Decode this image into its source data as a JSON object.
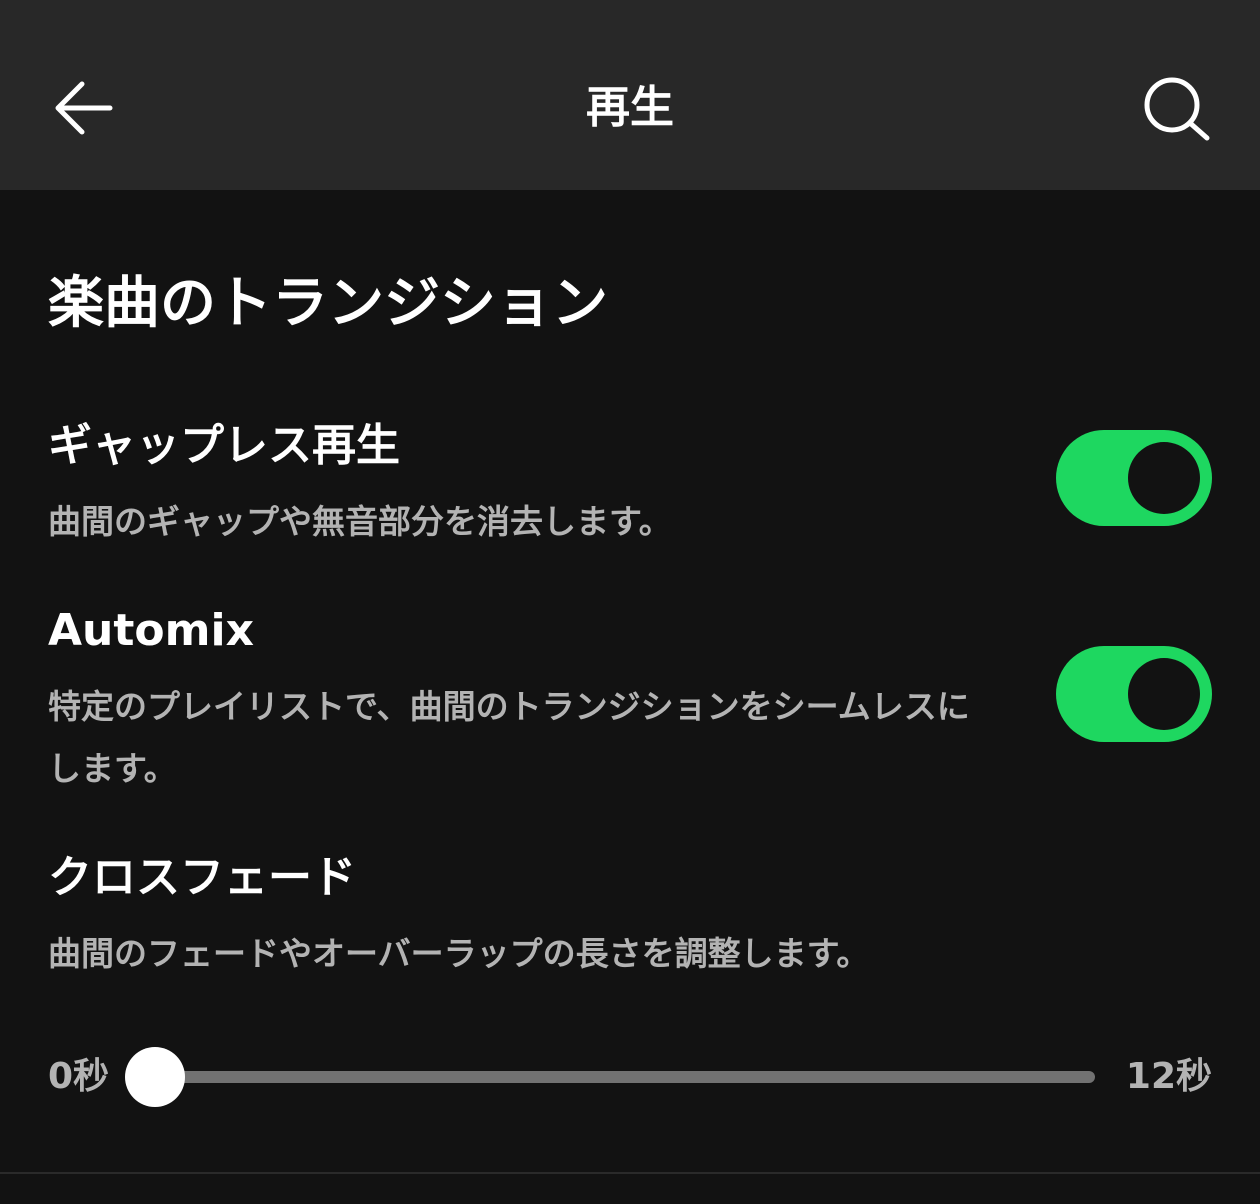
{
  "header": {
    "title": "再生",
    "back_icon": "arrow-left-icon",
    "search_icon": "search-icon"
  },
  "section": {
    "title": "楽曲のトランジション"
  },
  "settings": {
    "gapless": {
      "title": "ギャップレス再生",
      "description": "曲間のギャップや無音部分を消去します。",
      "enabled": true
    },
    "automix": {
      "title": "Automix",
      "description": "特定のプレイリストで、曲間のトランジションをシームレスにします。",
      "enabled": true
    },
    "crossfade": {
      "title": "クロスフェード",
      "description": "曲間のフェードやオーバーラップの長さを調整します。",
      "min_label": "0秒",
      "max_label": "12秒",
      "value_fraction": 0
    }
  },
  "colors": {
    "background": "#121212",
    "header_background": "#282828",
    "accent": "#1ed760",
    "secondary_text": "#b3b3b3"
  }
}
